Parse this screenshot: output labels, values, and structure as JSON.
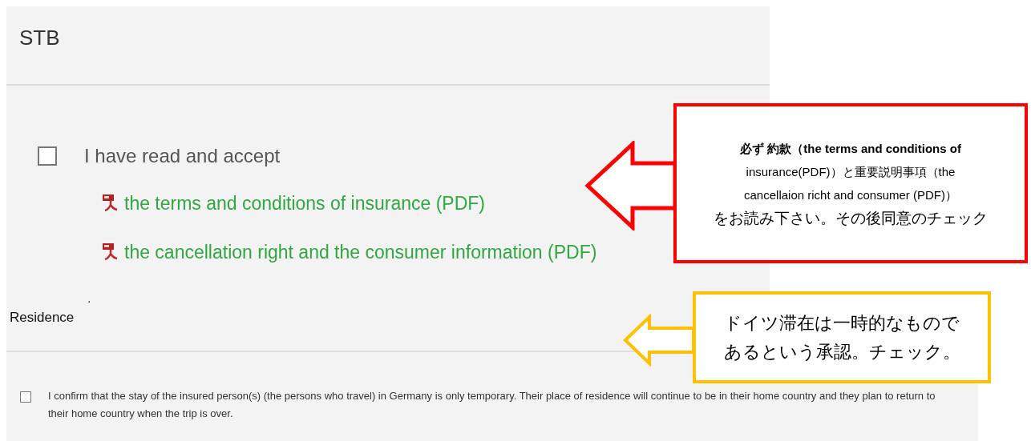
{
  "header": {
    "title": "STB"
  },
  "consent": {
    "checked": false,
    "label": "I have read and accept",
    "documents": [
      {
        "label": "the terms and conditions of insurance (PDF)"
      },
      {
        "label": "the cancellation right and the consumer information (PDF)"
      }
    ]
  },
  "stray_mark": ".",
  "residence": {
    "title": "Residence",
    "confirm": {
      "checked": false,
      "label": "I confirm that the stay of the insured person(s) (the persons who travel) in Germany is only temporary. Their place of residence will continue to be in their home country and they plan to return to their home country when the trip is over."
    }
  },
  "annotations": [
    {
      "color": "#ff0000",
      "lines": [
        "**必ず 約款（the terms and conditions of**",
        "insurance(PDF)）と重要説明事項（the",
        "cancellaion richt and consumer (PDF)）",
        "をお読み下さい。その後同意のチェック"
      ]
    },
    {
      "color": "#ffc000",
      "lines": [
        "ドイツ滞在は一時的なもので",
        "あるという承認。チェック。"
      ]
    }
  ]
}
